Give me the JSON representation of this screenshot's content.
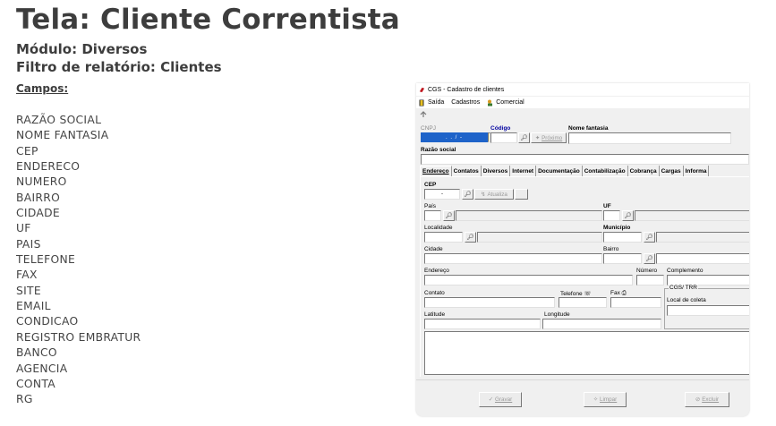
{
  "doc": {
    "title": "Tela: Cliente Correntista",
    "module": "Módulo: Diversos",
    "filter": "Filtro de relatório: Clientes",
    "fields_heading": "Campos:",
    "fields": [
      "RAZÃO SOCIAL",
      "NOME FANTASIA",
      "CEP",
      "ENDERECO",
      "NUMERO",
      "BAIRRO",
      "CIDADE",
      "UF",
      "PAIS",
      "TELEFONE",
      "FAX",
      "SITE",
      "EMAIL",
      "CONDICAO",
      "REGISTRO EMBRATUR",
      "BANCO",
      "AGENCIA",
      "CONTA",
      "RG"
    ]
  },
  "app": {
    "window_title": "CGS - Cadastro de clientes",
    "menu": {
      "exit": "Saída",
      "registers": "Cadastros",
      "commercial": "Comercial"
    },
    "cnpj_label": "CNPJ",
    "cnpj_value": ". . / -",
    "code_label": "Código",
    "next_button": "Próximo",
    "fantasy_label": "Nome fantasia",
    "corporate_label": "Razão social",
    "tabs": [
      "Endereço",
      "Contatos",
      "Diversos",
      "Internet",
      "Documentação",
      "Contabilização",
      "Cobrança",
      "Cargas",
      "Informa"
    ],
    "cep_label": "CEP",
    "cep_value": "-",
    "update_button": "Atualiza",
    "country_label": "País",
    "uf_label": "UF",
    "locality_label": "Localidade",
    "municipality_label": "Município",
    "city_label": "Cidade",
    "neighborhood_label": "Bairro",
    "address_label": "Endereço",
    "number_label": "Número",
    "complement_label": "Complemento",
    "contact_label": "Contato",
    "phone_label": "Telefone",
    "fax_label": "Fax",
    "cgs_group": "CGS/ TRR",
    "delivery_label": "Local de coleta",
    "latitude_label": "Latitude",
    "longitude_label": "Longitude",
    "save_button": "Gravar",
    "clear_button": "Limpar",
    "delete_button": "Excluir"
  },
  "colors": {
    "selection": "#1e63c9",
    "code_label": "#0000a0",
    "heading": "#3d3d3d"
  },
  "icons": [
    "app-icon",
    "door-icon",
    "people-icon",
    "arrow-icon",
    "binoculars-icon",
    "lightning-icon",
    "check-icon",
    "eraser-icon",
    "delete-icon",
    "phone-icon",
    "fax-icon"
  ]
}
